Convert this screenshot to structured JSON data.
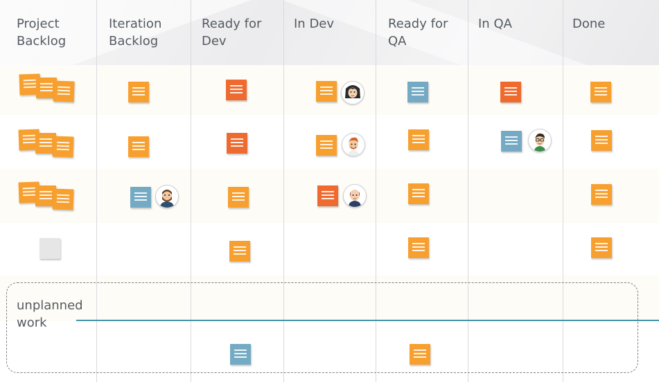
{
  "colors": {
    "orange": "#f7a030",
    "red_orange": "#ef6a2e",
    "blue": "#74aac3",
    "gray": "#e6e6e6",
    "swimlane_line": "#3f93a8"
  },
  "columns": [
    {
      "title": "Project\nBacklog"
    },
    {
      "title": "Iteration\nBacklog"
    },
    {
      "title": "Ready for\nDev"
    },
    {
      "title": "In Dev"
    },
    {
      "title": "Ready for\nQA"
    },
    {
      "title": "In QA"
    },
    {
      "title": "Done"
    }
  ],
  "swimlane": {
    "label": "unplanned\nwork"
  },
  "cards": [
    {
      "column": "Project Backlog",
      "row": 1,
      "color": "orange",
      "stack": 3
    },
    {
      "column": "Project Backlog",
      "row": 2,
      "color": "orange",
      "stack": 3
    },
    {
      "column": "Project Backlog",
      "row": 3,
      "color": "orange",
      "stack": 3
    },
    {
      "column": "Project Backlog",
      "row": 4,
      "color": "gray"
    },
    {
      "column": "Iteration Backlog",
      "row": 1,
      "color": "orange"
    },
    {
      "column": "Iteration Backlog",
      "row": 2,
      "color": "orange"
    },
    {
      "column": "Iteration Backlog",
      "row": 3,
      "color": "blue",
      "avatar": "bearded-man-avatar-icon"
    },
    {
      "column": "Ready for Dev",
      "row": 1,
      "color": "red_orange"
    },
    {
      "column": "Ready for Dev",
      "row": 2,
      "color": "red_orange"
    },
    {
      "column": "Ready for Dev",
      "row": 3,
      "color": "orange"
    },
    {
      "column": "Ready for Dev",
      "row": 4,
      "color": "orange"
    },
    {
      "column": "Ready for Dev",
      "row": 5,
      "color": "blue"
    },
    {
      "column": "In Dev",
      "row": 1,
      "color": "orange",
      "avatar": "woman-avatar-icon"
    },
    {
      "column": "In Dev",
      "row": 2,
      "color": "orange",
      "avatar": "red-haired-man-avatar-icon"
    },
    {
      "column": "In Dev",
      "row": 3,
      "color": "red_orange",
      "avatar": "bald-man-avatar-icon"
    },
    {
      "column": "Ready for QA",
      "row": 1,
      "color": "blue"
    },
    {
      "column": "Ready for QA",
      "row": 2,
      "color": "orange"
    },
    {
      "column": "Ready for QA",
      "row": 3,
      "color": "orange"
    },
    {
      "column": "Ready for QA",
      "row": 4,
      "color": "orange"
    },
    {
      "column": "Ready for QA",
      "row": 5,
      "color": "orange"
    },
    {
      "column": "In QA",
      "row": 1,
      "color": "red_orange"
    },
    {
      "column": "In QA",
      "row": 2,
      "color": "blue",
      "avatar": "glasses-man-avatar-icon"
    },
    {
      "column": "Done",
      "row": 1,
      "color": "orange"
    },
    {
      "column": "Done",
      "row": 2,
      "color": "orange"
    },
    {
      "column": "Done",
      "row": 3,
      "color": "orange"
    },
    {
      "column": "Done",
      "row": 4,
      "color": "orange"
    }
  ]
}
